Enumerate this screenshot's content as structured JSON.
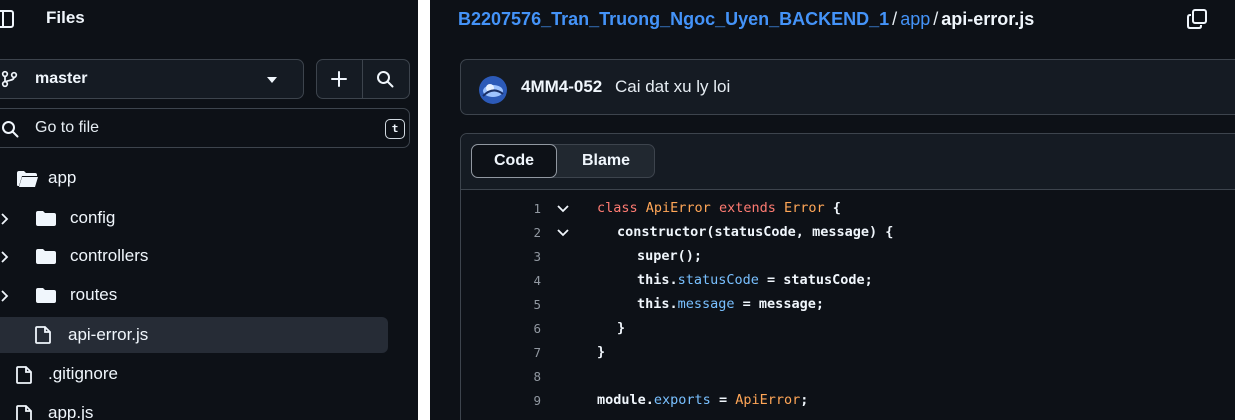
{
  "sidebar": {
    "title": "Files",
    "branch": "master",
    "goto_placeholder": "Go to file",
    "goto_shortcut": "t",
    "tree": [
      {
        "name": "app",
        "type": "folder-open",
        "level": 0
      },
      {
        "name": "config",
        "type": "folder",
        "level": 1
      },
      {
        "name": "controllers",
        "type": "folder",
        "level": 1
      },
      {
        "name": "routes",
        "type": "folder",
        "level": 1
      },
      {
        "name": "api-error.js",
        "type": "file",
        "level": 1,
        "selected": true
      },
      {
        "name": ".gitignore",
        "type": "file",
        "level": 0
      },
      {
        "name": "app.js",
        "type": "file",
        "level": 0
      }
    ]
  },
  "breadcrumb": {
    "repo": "B2207576_Tran_Truong_Ngoc_Uyen_BACKEND_1",
    "sep": "/",
    "dir": "app",
    "file": "api-error.js"
  },
  "commit": {
    "author": "4MM4-052",
    "message": "Cai dat xu ly loi"
  },
  "tabs": {
    "code": "Code",
    "blame": "Blame"
  },
  "code": {
    "line_numbers": [
      "1",
      "2",
      "3",
      "4",
      "5",
      "6",
      "7",
      "8",
      "9"
    ],
    "l1": {
      "kw": "class",
      "cls1": "ApiError",
      "kw2": "extends",
      "cls2": "Error",
      "tail": "{"
    },
    "l2": {
      "text": "constructor(statusCode, message) {"
    },
    "l3": {
      "text": "super();"
    },
    "l4": {
      "this": "this.",
      "prop": "statusCode",
      "tail": " = statusCode;"
    },
    "l5": {
      "this": "this.",
      "prop": "message",
      "tail": " = message;"
    },
    "l6": {
      "text": "}"
    },
    "l7": {
      "text": "}"
    },
    "l9": {
      "mod": "module.",
      "prop": "exports",
      "eq": " = ",
      "cls": "ApiError",
      "semi": ";"
    }
  },
  "colors": {
    "background": "#0d1117",
    "accent_link": "#4493f8",
    "keyword": "#ff7b72",
    "class_name": "#ffa657",
    "property": "#79c0ff"
  }
}
